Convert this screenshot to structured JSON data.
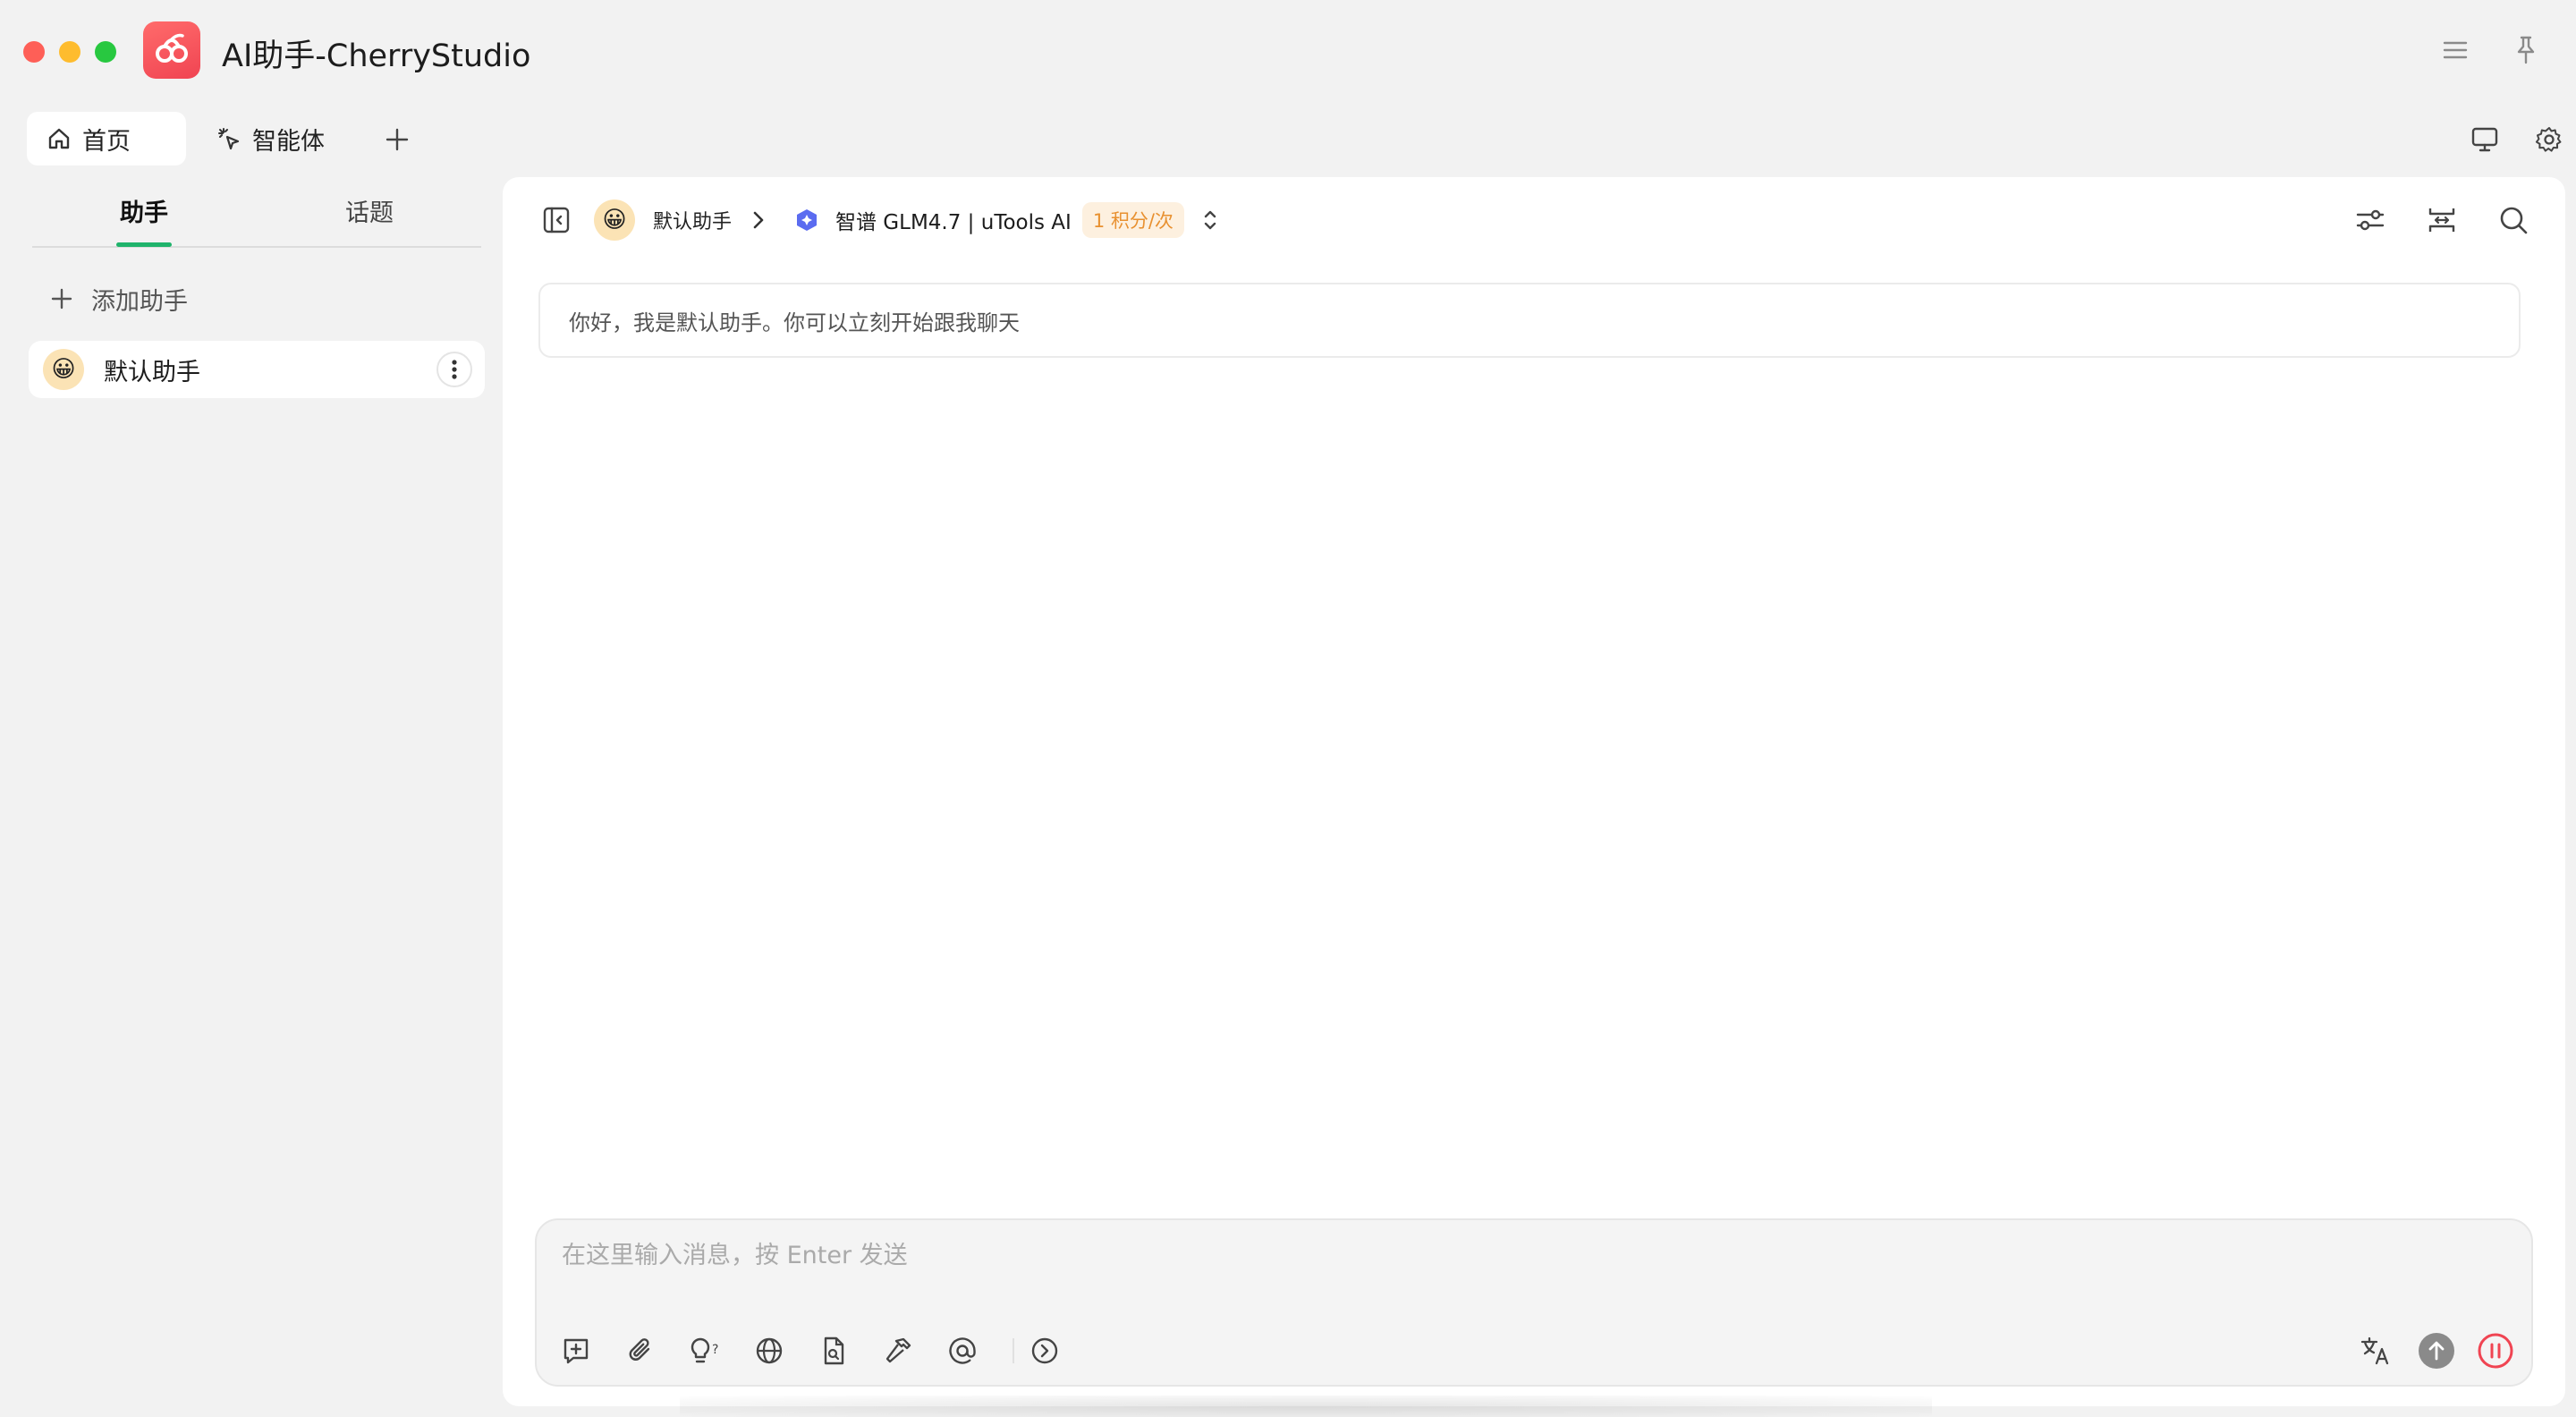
{
  "window": {
    "title": "AI助手-CherryStudio"
  },
  "tabs": [
    {
      "label": "首页",
      "icon": "home-icon",
      "active": true
    },
    {
      "label": "智能体",
      "icon": "sparkle-cursor-icon",
      "active": false
    }
  ],
  "sidebar": {
    "tabs": [
      {
        "label": "助手",
        "active": true
      },
      {
        "label": "话题",
        "active": false
      }
    ],
    "add_label": "添加助手",
    "assistants": [
      {
        "name": "默认助手",
        "avatar": "😀"
      }
    ],
    "accent_color": "#1fb36b"
  },
  "chat": {
    "header": {
      "assistant_name": "默认助手",
      "assistant_avatar": "😀",
      "model_name": "智谱 GLM4.7 | uTools AI",
      "model_badge": "1 积分/次"
    },
    "welcome_message": "你好，我是默认助手。你可以立刻开始跟我聊天",
    "input": {
      "value": "",
      "placeholder": "在这里输入消息，按 Enter 发送"
    }
  },
  "colors": {
    "app_logo": "#f04452",
    "close": "#fe5f57",
    "minimize": "#febc2e",
    "maximize": "#28c840",
    "stop_button": "#f04452",
    "send_button": "#8a8a8a",
    "badge_text": "#e8902f"
  }
}
